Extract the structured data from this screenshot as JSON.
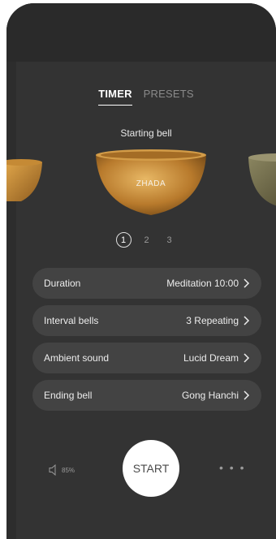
{
  "tabs": [
    {
      "label": "TIMER",
      "active": true
    },
    {
      "label": "PRESETS",
      "active": false
    }
  ],
  "bell_section": {
    "label": "Starting bell",
    "current_bowl": "ZHADA",
    "pages": [
      "1",
      "2",
      "3"
    ],
    "active_page": "1"
  },
  "settings": [
    {
      "label": "Duration",
      "value": "Meditation 10:00"
    },
    {
      "label": "Interval bells",
      "value": "3 Repeating"
    },
    {
      "label": "Ambient sound",
      "value": "Lucid Dream"
    },
    {
      "label": "Ending bell",
      "value": "Gong Hanchi"
    }
  ],
  "footer": {
    "volume": "85%",
    "start_label": "START",
    "more_label": "• • •"
  },
  "colors": {
    "background": "#333333",
    "row": "#434343",
    "accent": "#ffffff",
    "muted": "#8a8a8a"
  }
}
